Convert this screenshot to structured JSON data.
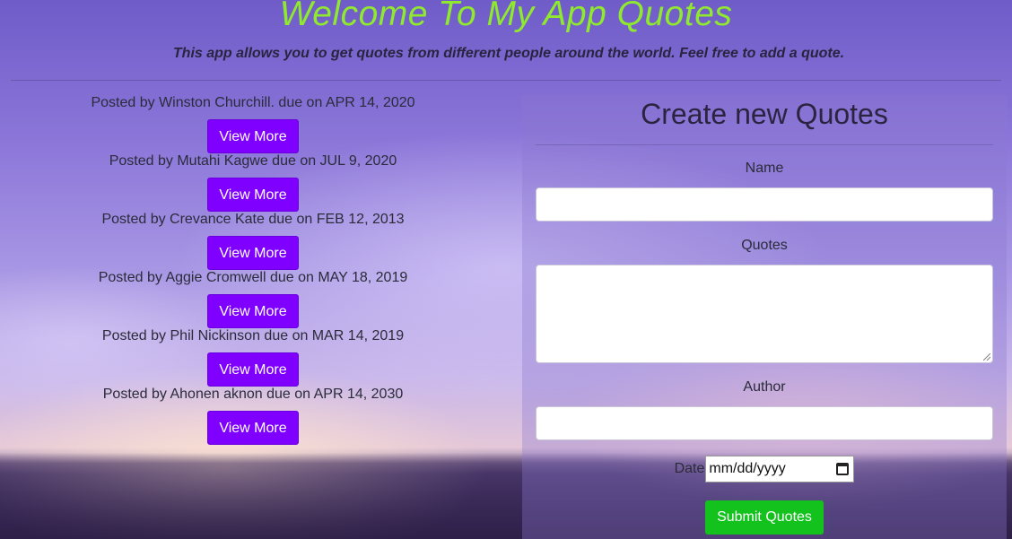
{
  "header": {
    "title": "Welcome To My App Quotes",
    "subtitle": "This app allows you to get quotes from different people around the world. Feel free to add a quote."
  },
  "quotes": [
    {
      "meta": "Posted by Winston Churchill. due on APR 14, 2020",
      "button": "View More"
    },
    {
      "meta": "Posted by Mutahi Kagwe due on JUL 9, 2020",
      "button": "View More"
    },
    {
      "meta": "Posted by Crevance Kate due on FEB 12, 2013",
      "button": "View More"
    },
    {
      "meta": "Posted by Aggie Cromwell due on MAY 18, 2019",
      "button": "View More"
    },
    {
      "meta": "Posted by Phil Nickinson due on MAR 14, 2019",
      "button": "View More"
    },
    {
      "meta": "Posted by Ahonen aknon due on APR 14, 2030",
      "button": "View More"
    }
  ],
  "form": {
    "title": "Create new Quotes",
    "name_label": "Name",
    "name_value": "",
    "quotes_label": "Quotes",
    "quotes_value": "",
    "author_label": "Author",
    "author_value": "",
    "date_label": "Date",
    "date_placeholder": "mm/dd/yyyy",
    "submit_label": "Submit Quotes"
  },
  "colors": {
    "title": "#8fea2e",
    "view_button": "#7f00ff",
    "submit_button": "#14c21e"
  },
  "icons": {
    "date_picker": "calendar-icon"
  }
}
